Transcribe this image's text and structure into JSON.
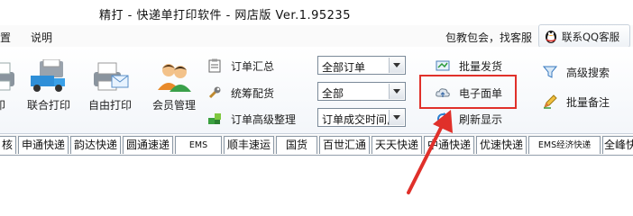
{
  "window": {
    "title": "精打 - 快递单打印软件 - 网店版 Ver.1.95235"
  },
  "menu": {
    "items": [
      "置",
      "说明"
    ],
    "help_text": "包教包会，找客服",
    "qq_button": "联系QQ客服"
  },
  "toolbar": {
    "large_tools": [
      {
        "label": "印",
        "icon": "printer-icon"
      },
      {
        "label": "联合打印",
        "icon": "truck-printer-icon"
      },
      {
        "label": "自由打印",
        "icon": "printer-envelope-icon"
      },
      {
        "label": "会员管理",
        "icon": "members-icon"
      }
    ],
    "order_tools": [
      {
        "label": "订单汇总",
        "icon": "clipboard-icon"
      },
      {
        "label": "统筹配货",
        "icon": "wrench-icon"
      },
      {
        "label": "订单高级整理",
        "icon": "blocks-icon"
      }
    ],
    "combos": [
      {
        "value": "全部订单"
      },
      {
        "value": "全部"
      },
      {
        "value": "订单成交时间,"
      }
    ],
    "action_tools": [
      {
        "label": "批量发货",
        "icon": "ship-icon"
      },
      {
        "label": "电子面单",
        "icon": "cloud-upload-icon"
      },
      {
        "label": "刷新显示",
        "icon": "refresh-icon"
      }
    ],
    "right_tools": [
      {
        "label": "高级搜索",
        "icon": "filter-icon"
      },
      {
        "label": "批量备注",
        "icon": "pencil-icon"
      }
    ]
  },
  "tabs": [
    {
      "label": "核",
      "small": false
    },
    {
      "label": "申通快递",
      "small": false
    },
    {
      "label": "韵达快递",
      "small": false
    },
    {
      "label": "圆通速递",
      "small": false
    },
    {
      "label": "EMS",
      "small": true
    },
    {
      "label": "顺丰速运",
      "small": false
    },
    {
      "label": "国货",
      "small": false
    },
    {
      "label": "百世汇通",
      "small": false
    },
    {
      "label": "天天快递",
      "small": false
    },
    {
      "label": "中通快递",
      "small": false
    },
    {
      "label": "优速快递",
      "small": false
    },
    {
      "label": "EMS经济快递",
      "small": true
    },
    {
      "label": "全峰快",
      "small": false
    }
  ],
  "colors": {
    "highlight": "#e0302a",
    "annotation_arrow": "#e0302a",
    "toolbar_bg": "#f3f6fa"
  }
}
